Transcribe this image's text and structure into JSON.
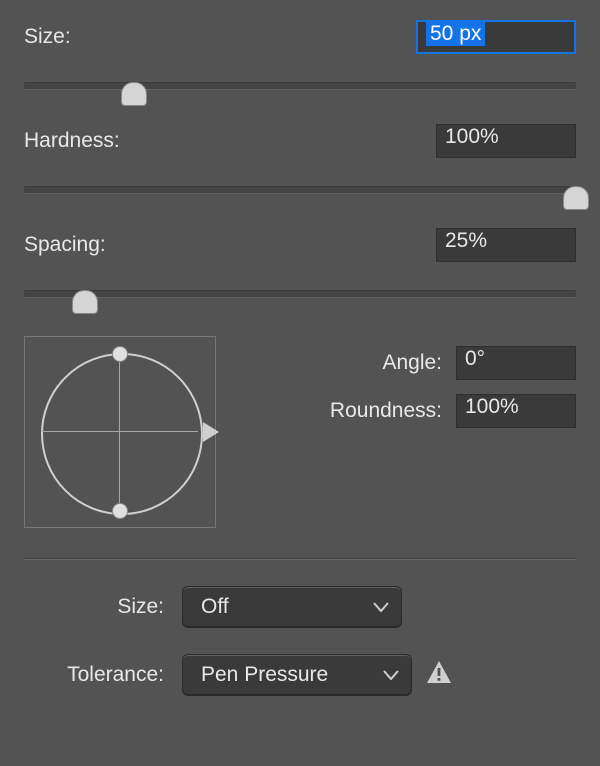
{
  "size": {
    "label": "Size:",
    "value": "50 px",
    "slider_pct": 20
  },
  "hardness": {
    "label": "Hardness:",
    "value": "100%",
    "slider_pct": 100
  },
  "spacing": {
    "label": "Spacing:",
    "value": "25%",
    "slider_pct": 11
  },
  "angle": {
    "label": "Angle:",
    "value": "0°"
  },
  "roundness": {
    "label": "Roundness:",
    "value": "100%"
  },
  "dyn_size": {
    "label": "Size:",
    "value": "Off"
  },
  "dyn_tolerance": {
    "label": "Tolerance:",
    "value": "Pen Pressure"
  }
}
